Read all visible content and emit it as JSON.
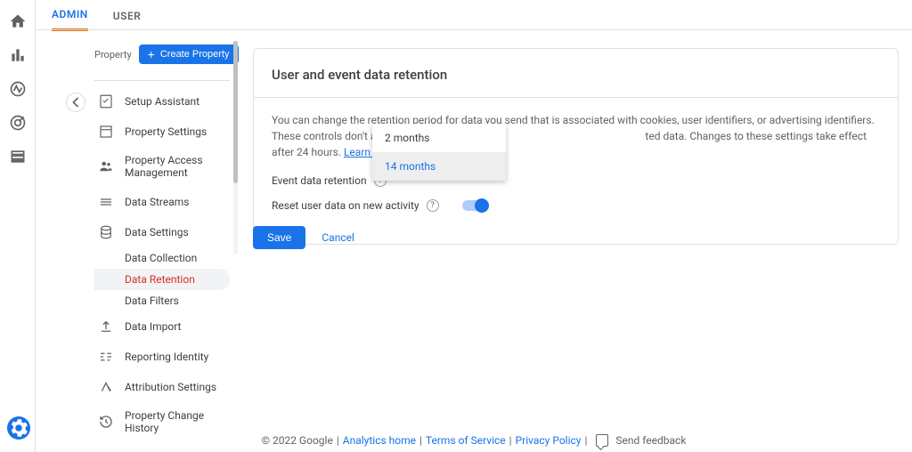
{
  "tabs": {
    "admin": "ADMIN",
    "user": "USER"
  },
  "property": {
    "label": "Property",
    "create": "Create Property"
  },
  "nav": {
    "setup": "Setup Assistant",
    "settings": "Property Settings",
    "access": "Property Access Management",
    "streams": "Data Streams",
    "dataSettings": "Data Settings",
    "sub": {
      "collection": "Data Collection",
      "retention": "Data Retention",
      "filters": "Data Filters"
    },
    "import": "Data Import",
    "reporting": "Reporting Identity",
    "attribution": "Attribution Settings",
    "history": "Property Change History"
  },
  "card": {
    "title": "User and event data retention",
    "desc_a": "You can change the retention period for data you send that is associated with cookies, user identifiers, or advertising identifiers. These controls don't affect most standard repo",
    "desc_b": "ted data. Changes to these settings take effect after 24 hours. ",
    "learn": "Learn more",
    "eventLabel": "Event data retention",
    "resetLabel": "Reset user data on new activity"
  },
  "dropdown": {
    "opt1": "2 months",
    "opt2": "14 months"
  },
  "actions": {
    "save": "Save",
    "cancel": "Cancel"
  },
  "footer": {
    "copyright": "© 2022 Google",
    "home": "Analytics home",
    "tos": "Terms of Service",
    "privacy": "Privacy Policy",
    "feedback": "Send feedback"
  }
}
